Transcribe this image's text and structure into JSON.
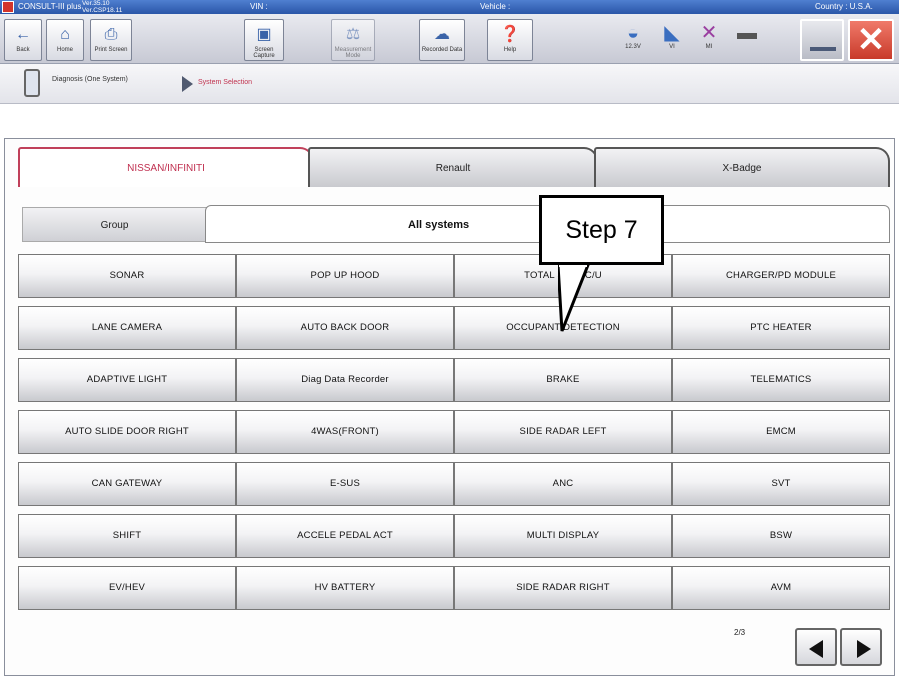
{
  "titlebar": {
    "app_name": "CONSULT-III plus",
    "version_line1": "Ver.35.10",
    "version_line2": "Ver.CSP18.11",
    "vin_label": "VIN :",
    "vehicle_label": "Vehicle :",
    "country_label": "Country : U.S.A."
  },
  "toolbar": {
    "buttons": [
      {
        "label": "Back",
        "icon": "arrow-left-icon"
      },
      {
        "label": "Home",
        "icon": "home-icon"
      },
      {
        "label": "Print Screen",
        "icon": "printer-icon"
      },
      {
        "label": "Screen Capture",
        "icon": "camera-icon"
      },
      {
        "label": "Measurement Mode",
        "icon": "measurement-icon"
      },
      {
        "label": "Recorded Data",
        "icon": "recorded-data-icon"
      },
      {
        "label": "Help",
        "icon": "help-icon"
      }
    ],
    "status": [
      {
        "label": "12.3V",
        "icon": "car-battery-icon"
      },
      {
        "label": "VI",
        "icon": "vi-icon"
      },
      {
        "label": "MI",
        "icon": "mi-icon"
      }
    ]
  },
  "breadcrumb": {
    "item1": "Diagnosis (One System)",
    "item2": "System Selection"
  },
  "tabs": [
    {
      "label": "NISSAN/INFINITI",
      "active": true
    },
    {
      "label": "Renault",
      "active": false
    },
    {
      "label": "X-Badge",
      "active": false
    }
  ],
  "group": {
    "label": "Group",
    "value": "All systems"
  },
  "systems": [
    [
      "SONAR",
      "POP UP HOOD",
      "TOTAL SEAT C/U",
      "CHARGER/PD MODULE"
    ],
    [
      "LANE CAMERA",
      "AUTO BACK DOOR",
      "OCCUPANT DETECTION",
      "PTC HEATER"
    ],
    [
      "ADAPTIVE LIGHT",
      "Diag Data Recorder",
      "BRAKE",
      "TELEMATICS"
    ],
    [
      "AUTO SLIDE DOOR RIGHT",
      "4WAS(FRONT)",
      "SIDE RADAR LEFT",
      "EMCM"
    ],
    [
      "CAN GATEWAY",
      "E-SUS",
      "ANC",
      "SVT"
    ],
    [
      "SHIFT",
      "ACCELE PEDAL ACT",
      "MULTI DISPLAY",
      "BSW"
    ],
    [
      "EV/HEV",
      "HV BATTERY",
      "SIDE RADAR RIGHT",
      "AVM"
    ]
  ],
  "pager": {
    "page": "2/3"
  },
  "callout": {
    "text": "Step 7"
  },
  "colors": {
    "accent": "#c0334f",
    "close": "#d24a3a"
  }
}
